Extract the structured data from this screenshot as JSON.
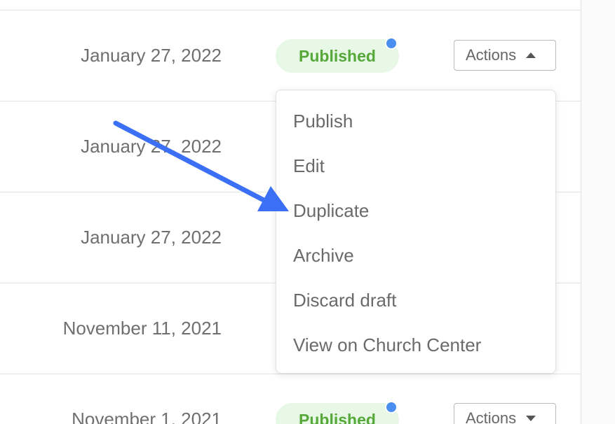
{
  "rows": [
    {
      "date": "January 27, 2022"
    },
    {
      "date": "January 27, 2022"
    },
    {
      "date": "January 27, 2022"
    },
    {
      "date": "November 11, 2021"
    },
    {
      "date": "November 1, 2021"
    }
  ],
  "status_badge": {
    "label": "Published",
    "color": "#56a83a",
    "background": "#e7f8e6",
    "dot_color": "#4a8ef0"
  },
  "actions": {
    "label": "Actions"
  },
  "menu": {
    "items": [
      {
        "label": "Publish"
      },
      {
        "label": "Edit"
      },
      {
        "label": "Duplicate"
      },
      {
        "label": "Archive"
      },
      {
        "label": "Discard draft"
      },
      {
        "label": "View on Church Center"
      }
    ]
  },
  "annotation": {
    "arrow_color": "#3b6ff5",
    "points_to": "Duplicate"
  }
}
